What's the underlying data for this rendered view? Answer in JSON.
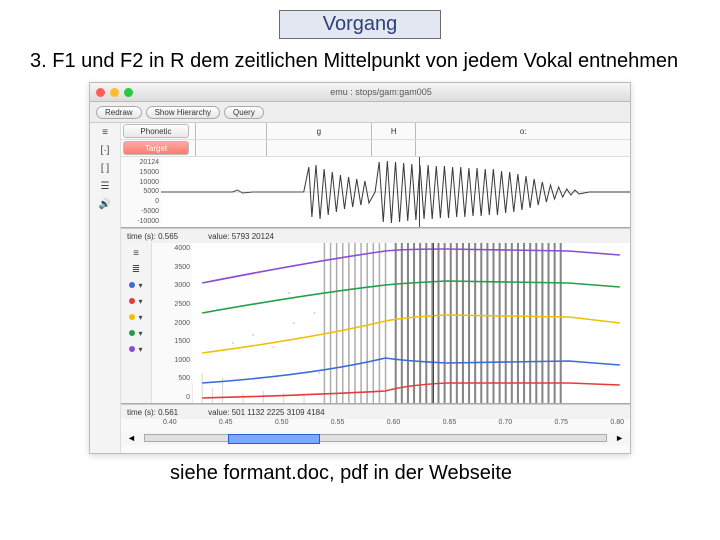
{
  "header": {
    "chip": "Vorgang"
  },
  "step": "3. F1 und F2 in R  dem zeitlichen Mittelpunkt von jedem Vokal entnehmen",
  "caption": "siehe formant.doc, pdf in der Webseite",
  "app": {
    "title": "emu : stops/gam:gam005",
    "toolbar": {
      "redraw": "Redraw",
      "show_hierarchy": "Show Hierarchy",
      "query": "Query"
    },
    "tiers": {
      "phonetic": {
        "label": "Phonetic",
        "cells": [
          "g",
          "H",
          "o:"
        ]
      },
      "target": {
        "label": "Target"
      }
    },
    "wave": {
      "yticks": [
        "20124",
        "15000",
        "10000",
        "5000",
        "0",
        "-5000",
        "-10000"
      ],
      "status_time_label": "time (s): 0.565",
      "status_value": "value: 5793 20124"
    },
    "spec": {
      "yticks": [
        "4000",
        "3500",
        "3000",
        "2500",
        "2000",
        "1500",
        "1000",
        "500",
        "0"
      ],
      "status_time_label": "time (s): 0.561",
      "status_value": "value: 501 1132 2225 3109 4184",
      "xticks": [
        "0.40",
        "0.45",
        "0.50",
        "0.55",
        "0.60",
        "0.65",
        "0.70",
        "0.75",
        "0.80"
      ]
    },
    "legend_colors": [
      "#3a6bd6",
      "#e33c3c",
      "#f0c000",
      "#21a047",
      "#8a4bd6"
    ],
    "side_icons": [
      "menu-icon",
      "brackets-icon",
      "brackets2-icon",
      "equalizer-icon",
      "speaker-icon"
    ]
  }
}
